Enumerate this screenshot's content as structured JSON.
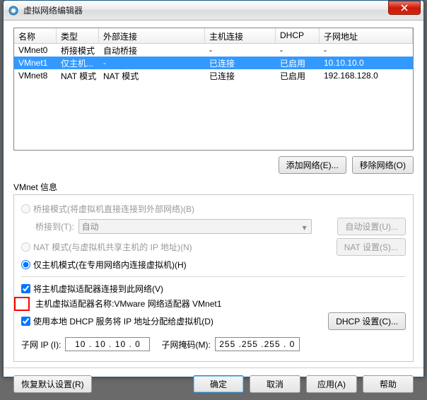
{
  "window": {
    "title": "虚拟网络编辑器"
  },
  "table": {
    "headers": {
      "name": "名称",
      "type": "类型",
      "external": "外部连接",
      "host": "主机连接",
      "dhcp": "DHCP",
      "subnet": "子网地址"
    },
    "rows": [
      {
        "name": "VMnet0",
        "type": "桥接模式",
        "external": "自动桥接",
        "host": "-",
        "dhcp": "-",
        "subnet": "-",
        "selected": false
      },
      {
        "name": "VMnet1",
        "type": "仅主机...",
        "external": "-",
        "host": "已连接",
        "dhcp": "已启用",
        "subnet": "10.10.10.0",
        "selected": true
      },
      {
        "name": "VMnet8",
        "type": "NAT 模式",
        "external": "NAT 模式",
        "host": "已连接",
        "dhcp": "已启用",
        "subnet": "192.168.128.0",
        "selected": false
      }
    ]
  },
  "buttons": {
    "add_network": "添加网络(E)...",
    "remove_network": "移除网络(O)",
    "auto_settings": "自动设置(U)...",
    "nat_settings": "NAT 设置(S)...",
    "dhcp_settings": "DHCP 设置(C)...",
    "restore_defaults": "恢复默认设置(R)",
    "ok": "确定",
    "cancel": "取消",
    "apply": "应用(A)",
    "help": "帮助"
  },
  "section": {
    "vmnet_info": "VMnet 信息",
    "bridged_label": "桥接模式(将虚拟机直接连接到外部网络)(B)",
    "bridged_to": "桥接到(T):",
    "bridged_combo": "自动",
    "nat_label": "NAT 模式(与虚拟机共享主机的 IP 地址)(N)",
    "hostonly_label": "仅主机模式(在专用网络内连接虚拟机)(H)",
    "connect_adapter": "将主机虚拟适配器连接到此网络(V)",
    "adapter_name_label": "主机虚拟适配器名称: ",
    "adapter_name_value": "VMware 网络适配器 VMnet1",
    "use_dhcp": "使用本地 DHCP 服务将 IP 地址分配给虚拟机(D)",
    "subnet_ip_label": "子网 IP (I):",
    "subnet_ip_value": "10 . 10 . 10 . 0",
    "subnet_mask_label": "子网掩码(M):",
    "subnet_mask_value": "255 .255 .255 . 0"
  }
}
